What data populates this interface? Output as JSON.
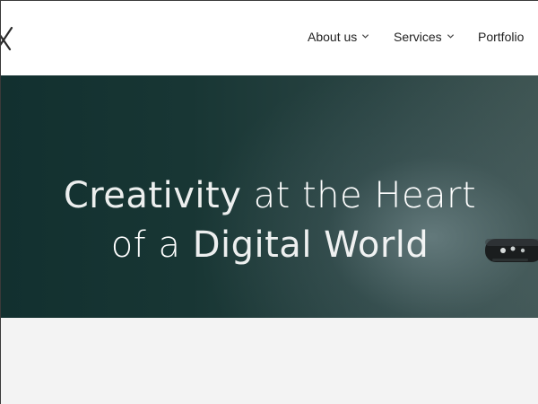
{
  "header": {
    "logo_icon": "x-logo-icon",
    "nav": [
      {
        "label": "About us",
        "has_dropdown": true
      },
      {
        "label": "Services",
        "has_dropdown": true
      },
      {
        "label": "Portfolio",
        "has_dropdown": false
      }
    ]
  },
  "hero": {
    "title_line1_emph": "Creativity",
    "title_line1_rest": " at the Heart",
    "title_line2_pre": "of a ",
    "title_line2_emph": "Digital World"
  },
  "colors": {
    "header_bg": "#ffffff",
    "hero_dark": "#12302f",
    "content_bg": "#f3f3f3",
    "nav_text": "#222222"
  }
}
